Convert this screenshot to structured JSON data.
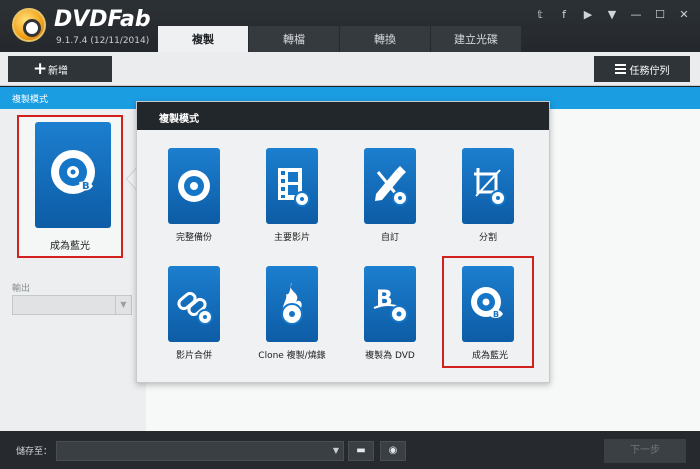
{
  "app": {
    "brand": "DVDFab",
    "version": "9.1.7.4 (12/11/2014)"
  },
  "tabs": [
    {
      "label": "複製",
      "active": true
    },
    {
      "label": "轉檔",
      "active": false
    },
    {
      "label": "轉換",
      "active": false
    },
    {
      "label": "建立光碟",
      "active": false
    }
  ],
  "window_icons": [
    "twitter-icon",
    "facebook-icon",
    "youtube-icon",
    "menu-dropdown-icon",
    "minimize-icon",
    "maximize-icon",
    "close-icon"
  ],
  "toolbar": {
    "add_label": "新增",
    "queue_label": "任務佇列"
  },
  "mode_bar": {
    "title": "複製模式"
  },
  "left_panel": {
    "selected_mode_label": "成為藍光",
    "output_label": "輸出",
    "output_value": ""
  },
  "popup": {
    "title": "複製模式",
    "options": [
      {
        "label": "完整備份",
        "icon": "disc-icon"
      },
      {
        "label": "主要影片",
        "icon": "film-disc-icon"
      },
      {
        "label": "自訂",
        "icon": "pencil-disc-icon"
      },
      {
        "label": "分割",
        "icon": "crop-disc-icon"
      },
      {
        "label": "影片合併",
        "icon": "link-disc-icon"
      },
      {
        "label": "Clone 複製/燒錄",
        "icon": "flame-disc-icon"
      },
      {
        "label": "複製為 DVD",
        "icon": "bluray-to-dvd-icon"
      },
      {
        "label": "成為藍光",
        "icon": "dvd-to-bluray-icon",
        "highlighted": true
      }
    ]
  },
  "bottombar": {
    "save_label": "儲存至：",
    "save_path": "",
    "next_label": "下一步"
  },
  "colors": {
    "accent_blue": "#1b9de2",
    "tile_blue": "#1576c8",
    "highlight_red": "#d41f1f",
    "dark_bg": "#24282c"
  }
}
